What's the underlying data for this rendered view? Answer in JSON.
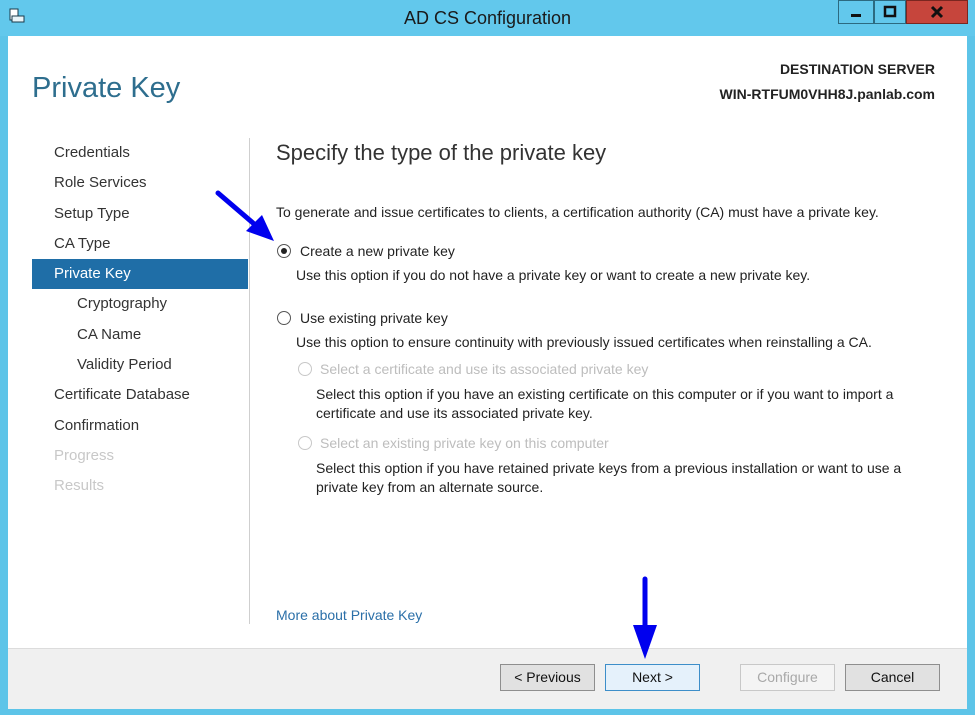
{
  "window": {
    "title": "AD CS Configuration"
  },
  "header": {
    "page_title": "Private Key",
    "destination_label": "DESTINATION SERVER",
    "destination_name": "WIN-RTFUM0VHH8J.panlab.com"
  },
  "sidebar": {
    "items": [
      {
        "label": "Credentials",
        "state": "normal"
      },
      {
        "label": "Role Services",
        "state": "normal"
      },
      {
        "label": "Setup Type",
        "state": "normal"
      },
      {
        "label": "CA Type",
        "state": "normal"
      },
      {
        "label": "Private Key",
        "state": "active"
      },
      {
        "label": "Cryptography",
        "state": "sub"
      },
      {
        "label": "CA Name",
        "state": "sub"
      },
      {
        "label": "Validity Period",
        "state": "sub"
      },
      {
        "label": "Certificate Database",
        "state": "normal"
      },
      {
        "label": "Confirmation",
        "state": "normal"
      },
      {
        "label": "Progress",
        "state": "disabled"
      },
      {
        "label": "Results",
        "state": "disabled"
      }
    ]
  },
  "main": {
    "heading": "Specify the type of the private key",
    "intro": "To generate and issue certificates to clients, a certification authority (CA) must have a private key.",
    "options": {
      "create_new": {
        "label": "Create a new private key",
        "description": "Use this option if you do not have a private key or want to create a new private key.",
        "selected": true
      },
      "use_existing": {
        "label": "Use existing private key",
        "description": "Use this option to ensure continuity with previously issued certificates when reinstalling a CA.",
        "selected": false
      },
      "select_certificate": {
        "label": "Select a certificate and use its associated private key",
        "description": "Select this option if you have an existing certificate on this computer or if you want to import a certificate and use its associated private key.",
        "enabled": false
      },
      "select_existing_key": {
        "label": "Select an existing private key on this computer",
        "description": "Select this option if you have retained private keys from a previous installation or want to use a private key from an alternate source.",
        "enabled": false
      }
    },
    "more_link": "More about Private Key"
  },
  "footer": {
    "previous": "< Previous",
    "next": "Next >",
    "configure": "Configure",
    "cancel": "Cancel"
  },
  "colors": {
    "accent": "#1f6ea7",
    "title_bar": "#62c8ec",
    "arrow": "#0000ee"
  }
}
